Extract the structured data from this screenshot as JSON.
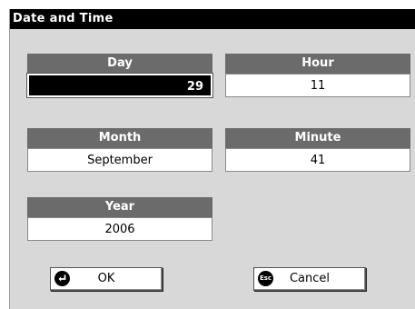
{
  "window": {
    "title": "Date and Time"
  },
  "fields": {
    "day": {
      "label": "Day",
      "value": "29"
    },
    "hour": {
      "label": "Hour",
      "value": "11"
    },
    "month": {
      "label": "Month",
      "value": "September"
    },
    "minute": {
      "label": "Minute",
      "value": "41"
    },
    "year": {
      "label": "Year",
      "value": "2006"
    }
  },
  "buttons": {
    "ok": {
      "label": "OK",
      "icon": "enter-icon"
    },
    "cancel": {
      "label": "Cancel",
      "icon": "esc-icon",
      "icon_text": "Esc"
    }
  }
}
